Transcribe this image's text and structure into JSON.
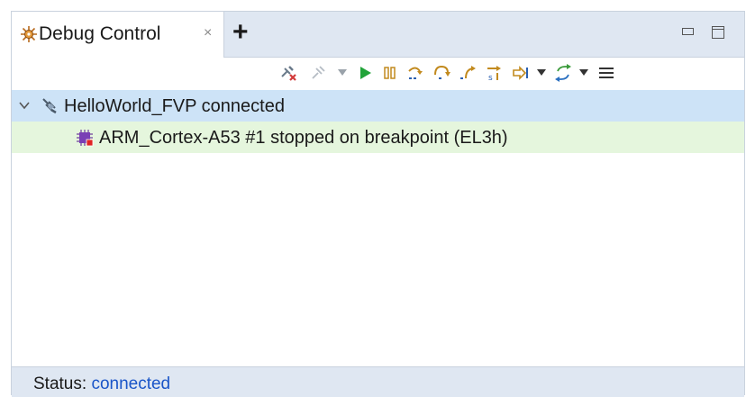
{
  "view": {
    "tab_title": "Debug Control",
    "tab_close_glyph": "×",
    "tab_add_glyph": "+",
    "tab_icon": "debug-control-icon"
  },
  "toolbar": {
    "buttons": [
      "disconnect-icon",
      "connect-icon",
      "dropdown",
      "continue-icon",
      "pause-icon",
      "step-source-line-icon",
      "step-over-icon",
      "step-out-icon",
      "step-instruction-icon",
      "run-to-icon",
      "dropdown",
      "sync-icon",
      "dropdown",
      "view-menu-icon"
    ]
  },
  "tree": {
    "target": {
      "label": "HelloWorld_FVP connected",
      "expanded": true,
      "icon": "target-connection-icon"
    },
    "core": {
      "label": "ARM_Cortex-A53 #1 stopped on breakpoint (EL3h)",
      "icon": "cpu-core-icon"
    }
  },
  "status": {
    "label": "Status:",
    "value": "connected"
  },
  "colors": {
    "tab_bar_bg": "#dfe7f2",
    "selected_row_bg": "#cde3f7",
    "stopped_row_bg": "#e5f6dd",
    "status_link": "#1a55c8",
    "continue_green": "#22a33a"
  }
}
